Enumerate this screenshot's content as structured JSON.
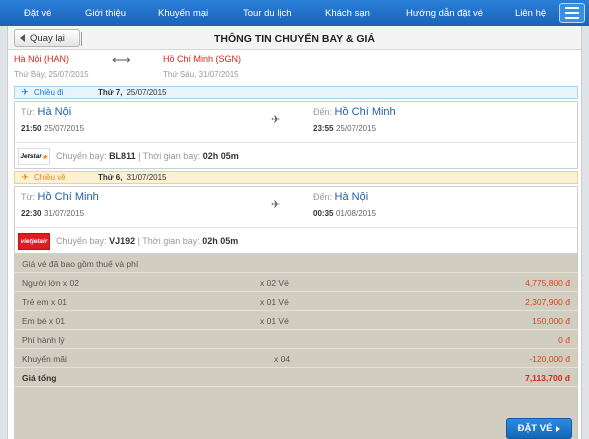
{
  "nav": {
    "items": [
      "Đặt vé",
      "Giới thiệu",
      "Khuyến mại",
      "Tour du lịch",
      "Khách sạn",
      "Hướng dẫn đặt vé",
      "Liên hệ"
    ]
  },
  "header": {
    "back_label": "Quay lại",
    "title": "THÔNG TIN CHUYẾN BAY & GIÁ"
  },
  "route": {
    "origin": "Hà Nội (HAN)",
    "origin_date": "Thứ Bảy, 25/07/2015",
    "destination": "Hồ Chí Minh (SGN)",
    "destination_date": "Thứ Sáu, 31/07/2015",
    "arrow": "⟷"
  },
  "outbound": {
    "label": "Chiều đi",
    "day": "Thứ 7,",
    "date": "25/07/2015",
    "from_prefix": "Từ:",
    "from_city": "Hà Nội",
    "depart_time": "21:50",
    "depart_date": "25/07/2015",
    "to_prefix": "Đến:",
    "to_city": "Hồ Chí Minh",
    "arrive_time": "23:55",
    "arrive_date": "25/07/2015",
    "flight_prefix": "Chuyến bay:",
    "flight_no": "BL811",
    "duration_prefix": "| Thời gian bay:",
    "duration": "02h 05m",
    "carrier_logo_text": "Jetstar"
  },
  "inbound": {
    "label": "Chiều về",
    "day": "Thứ 6,",
    "date": "31/07/2015",
    "from_prefix": "Từ:",
    "from_city": "Hồ Chí Minh",
    "depart_time": "22:30",
    "depart_date": "31/07/2015",
    "to_prefix": "Đến:",
    "to_city": "Hà Nội",
    "arrive_time": "00:35",
    "arrive_date": "01/08/2015",
    "flight_prefix": "Chuyến bay:",
    "flight_no": "VJ192",
    "duration_prefix": "| Thời gian bay:",
    "duration": "02h 05m",
    "carrier_logo_text": "vietjetair"
  },
  "pricing": {
    "note": "Giá vé đã bao gồm thuế và phí",
    "rows": [
      {
        "label": "Người lớn x 02",
        "qty": "x 02 Vé",
        "amount": "4,775,800 đ"
      },
      {
        "label": "Trẻ em x 01",
        "qty": "x 01 Vé",
        "amount": "2,307,900 đ"
      },
      {
        "label": "Em bé x 01",
        "qty": "x 01 Vé",
        "amount": "150,000 đ"
      },
      {
        "label": "Phí hành lý",
        "qty": "",
        "amount": "0 đ"
      },
      {
        "label": "Khuyến mãi",
        "qty": "x 04",
        "amount": "-120,000 đ"
      }
    ],
    "total_label": "Giá tổng",
    "total_amount": "7,113,700 đ",
    "book_label": "ĐẶT VÉ"
  },
  "colors": {
    "nav_blue": "#1a63b8",
    "accent_red": "#d9251c",
    "depart_bar": "#e8f4fb",
    "return_bar": "#fdf1d3",
    "price_panel": "#d2cdc1"
  }
}
